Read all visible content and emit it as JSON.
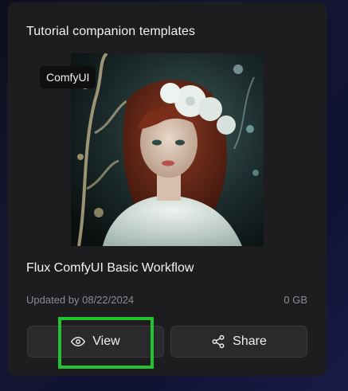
{
  "card": {
    "header": "Tutorial companion templates",
    "badge": "ComfyUI",
    "title": "Flux ComfyUI Basic Workflow",
    "updated": "Updated by 08/22/2024",
    "size": "0 GB",
    "thumbnail_icon": "portrait-image"
  },
  "buttons": {
    "view_label": "View",
    "view_icon": "eye-icon",
    "share_label": "Share",
    "share_icon": "share-icon"
  },
  "colors": {
    "highlight": "#22c230",
    "card_bg": "#1d1d20",
    "button_bg": "#2a2a2d"
  }
}
